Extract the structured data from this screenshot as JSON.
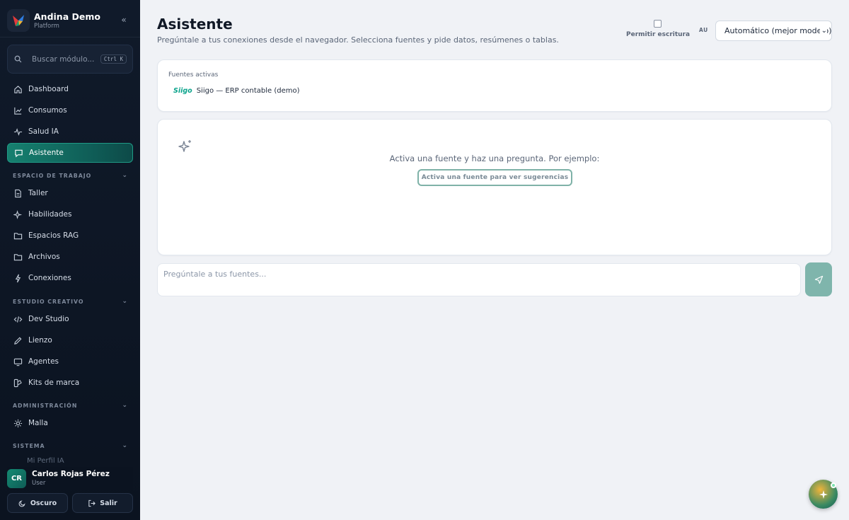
{
  "brand": {
    "title": "Andina Demo",
    "subtitle": "Platform"
  },
  "search": {
    "placeholder": "Buscar módulo...",
    "shortcut": "Ctrl K"
  },
  "nav": {
    "primary": [
      {
        "label": "Dashboard",
        "icon": "home-icon"
      },
      {
        "label": "Consumos",
        "icon": "chart-line-icon"
      },
      {
        "label": "Salud IA",
        "icon": "pulse-icon"
      },
      {
        "label": "Asistente",
        "icon": "chat-icon",
        "active": true
      }
    ],
    "sections": [
      {
        "title": "ESPACIO DE TRABAJO",
        "items": [
          {
            "label": "Taller",
            "icon": "file-icon"
          },
          {
            "label": "Habilidades",
            "icon": "sparkle-icon"
          },
          {
            "label": "Espacios RAG",
            "icon": "folder-icon"
          },
          {
            "label": "Archivos",
            "icon": "folder-icon"
          },
          {
            "label": "Conexiones",
            "icon": "plug-icon"
          }
        ]
      },
      {
        "title": "ESTUDIO CREATIVO",
        "items": [
          {
            "label": "Dev Studio",
            "icon": "code-icon"
          },
          {
            "label": "Lienzo",
            "icon": "pencil-icon"
          },
          {
            "label": "Agentes",
            "icon": "monitor-icon"
          },
          {
            "label": "Kits de marca",
            "icon": "palette-icon"
          }
        ]
      },
      {
        "title": "ADMINISTRACIÓN",
        "items": [
          {
            "label": "Malla",
            "icon": "sun-icon"
          }
        ]
      },
      {
        "title": "SISTEMA",
        "items": [
          {
            "label": "Mi Perfil IA",
            "icon": "user-icon"
          }
        ]
      }
    ]
  },
  "user": {
    "initials": "CR",
    "name": "Carlos Rojas Pérez",
    "role": "User"
  },
  "footer": {
    "theme_label": "Oscuro",
    "logout_label": "Salir"
  },
  "header": {
    "title": "Asistente",
    "subtitle": "Pregúntale a tus conexiones desde el navegador. Selecciona fuentes y pide datos, resúmenes o tablas.",
    "write_label": "Permitir escritura",
    "write_checked": false,
    "model_tag": "AU",
    "model_value": "Automático (mejor modelo)"
  },
  "sources": {
    "title": "Fuentes activas",
    "items": [
      {
        "logo_text": "Siigo",
        "label": "Siigo — ERP contable (demo)"
      }
    ]
  },
  "empty_state": {
    "text": "Activa una fuente y haz una pregunta. Por ejemplo:",
    "suggest_label": "Activa una fuente para ver sugerencias"
  },
  "chat": {
    "placeholder": "Pregúntale a tus fuentes..."
  },
  "colors": {
    "accent": "#16806f",
    "sidebar_bg": "#101a2a",
    "page_bg": "#f0f2f6"
  }
}
